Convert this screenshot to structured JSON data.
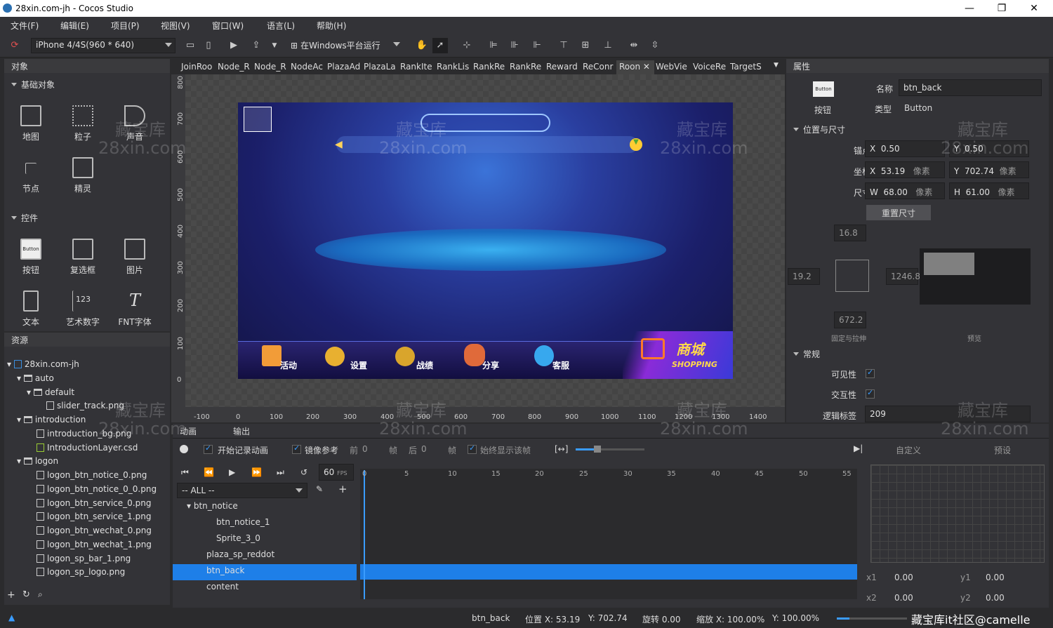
{
  "window": {
    "title": "28xin.com-jh - Cocos Studio",
    "min": "—",
    "max": "❐",
    "close": "✕"
  },
  "menu": [
    "文件(F)",
    "编辑(E)",
    "项目(P)",
    "视图(V)",
    "窗口(W)",
    "语言(L)",
    "帮助(H)"
  ],
  "toolbar": {
    "device": "iPhone 4/4S(960 * 640)",
    "run": "在Windows平台运行"
  },
  "objects_panel": {
    "title": "对象",
    "section_basic": "基础对象",
    "basic": [
      "地图",
      "粒子",
      "声音",
      "节点",
      "精灵"
    ],
    "section_controls": "控件",
    "controls": [
      "按钮",
      "复选框",
      "图片",
      "文本",
      "艺术数字",
      "FNT字体"
    ],
    "button_icon_text": "Button",
    "art_number_icon_text": "123"
  },
  "resources_panel": {
    "title": "资源",
    "items": [
      "28xin.com-jh",
      "auto",
      "default",
      "slider_track.png",
      "introduction",
      "introduction_bg.png",
      "IntroductionLayer.csd",
      "logon",
      "logon_btn_notice_0.png",
      "logon_btn_notice_0_0.png",
      "logon_btn_service_0.png",
      "logon_btn_service_1.png",
      "logon_btn_wechat_0.png",
      "logon_btn_wechat_1.png",
      "logon_sp_bar_1.png",
      "logon_sp_logo.png"
    ]
  },
  "tabs": [
    "JoinRoo",
    "Node_R",
    "Node_R",
    "NodeAc",
    "PlazaAd",
    "PlazaLa",
    "RankIte",
    "RankLis",
    "RankRe",
    "RankRe",
    "Reward",
    "ReConr",
    "Roon",
    "WebVie",
    "VoiceRe",
    "TargetS"
  ],
  "ruler_h": [
    "-100",
    "0",
    "100",
    "200",
    "300",
    "400",
    "500",
    "600",
    "700",
    "800",
    "900",
    "1000",
    "1100",
    "1200",
    "1300",
    "1400"
  ],
  "ruler_v": [
    "800",
    "700",
    "600",
    "500",
    "400",
    "300",
    "200",
    "100",
    "0"
  ],
  "scene": {
    "menu": [
      "活动",
      "设置",
      "战绩",
      "分享",
      "客服"
    ],
    "shop_cn": "商城",
    "shop_en": "SHOPPING"
  },
  "props": {
    "title": "属性",
    "name_label": "名称",
    "name_value": "btn_back",
    "type_label": "类型",
    "type_value": "Button",
    "icon_text": "Button",
    "icon_label": "按钮",
    "section_pos": "位置与尺寸",
    "anchor_label": "锚点",
    "anchor_x": "0.50",
    "anchor_y": "0.50",
    "pos_label": "坐标",
    "pos_x": "53.19",
    "pos_y": "702.74",
    "unit": "像素",
    "size_label": "尺寸",
    "size_w": "68.00",
    "size_h": "61.00",
    "reset": "重置尺寸",
    "top": "16.8",
    "left": "19.2",
    "right": "1246.8",
    "bottom": "672.2",
    "fixed_label": "固定与拉伸",
    "preview_label": "预览",
    "section_general": "常规",
    "visible": "可见性",
    "interactive": "交互性",
    "tag_label": "逻辑标签",
    "tag_value": "209",
    "x": "X",
    "y": "Y",
    "w": "W",
    "h": "H"
  },
  "timeline": {
    "tab_anim": "动画",
    "tab_output": "输出",
    "record": "开始记录动画",
    "mirror": "镜像参考",
    "prev": "前",
    "prev_val": "0",
    "frame": "帧",
    "next": "后",
    "next_val": "0",
    "always": "始终显示该帧",
    "fps": "60",
    "fps_label": "FPS",
    "filter": "-- ALL --",
    "rows": [
      "btn_notice",
      "btn_notice_1",
      "Sprite_3_0",
      "plaza_sp_reddot",
      "btn_back",
      "content"
    ],
    "ticks": [
      "0",
      "5",
      "10",
      "15",
      "20",
      "25",
      "30",
      "35",
      "40",
      "45",
      "50",
      "55"
    ],
    "custom": "自定义",
    "preset": "预设",
    "x1": "x1",
    "x1v": "0.00",
    "y1": "y1",
    "y1v": "0.00",
    "x2": "x2",
    "x2v": "0.00",
    "y2": "y2",
    "y2v": "0.00"
  },
  "status": {
    "name": "btn_back",
    "pos": "位置 X: 53.19",
    "posy": "Y: 702.74",
    "rot": "旋转 0.00",
    "scale": "缩放 X: 100.00%",
    "scaley": "Y: 100.00%",
    "brand": "藏宝库it社区@camelle"
  },
  "watermark": {
    "cn": "藏宝库",
    "en": "28xin.com"
  },
  "colors": {
    "accent": "#1e7fe8",
    "panel": "#333337",
    "bg": "#2b2b2d"
  }
}
